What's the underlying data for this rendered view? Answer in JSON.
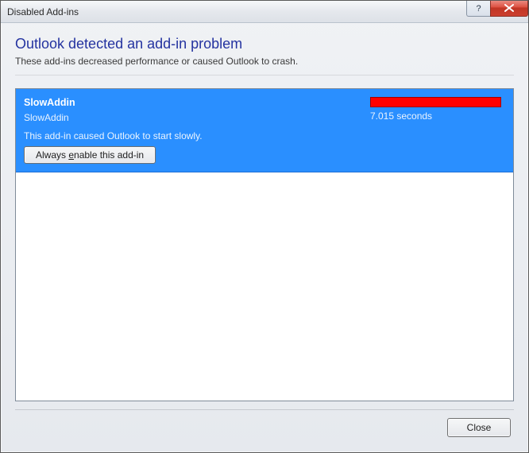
{
  "window": {
    "title": "Disabled Add-ins"
  },
  "header": {
    "heading": "Outlook detected an add-in problem",
    "subheading": "These add-ins decreased performance or caused Outlook to crash."
  },
  "addins": [
    {
      "name": "SlowAddin",
      "publisher": "SlowAddin",
      "duration_text": "7.015 seconds",
      "message": "This add-in caused Outlook to start slowly.",
      "enable_prefix": "Always ",
      "enable_hotkey": "e",
      "enable_suffix": "nable this add-in",
      "bar_color": "#ff0000"
    }
  ],
  "footer": {
    "close_label": "Close"
  }
}
